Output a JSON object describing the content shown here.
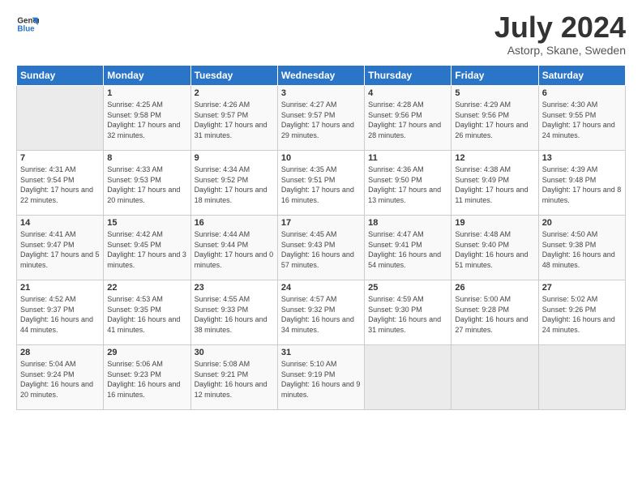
{
  "logo": {
    "line1": "General",
    "line2": "Blue"
  },
  "title": "July 2024",
  "subtitle": "Astorp, Skane, Sweden",
  "days_header": [
    "Sunday",
    "Monday",
    "Tuesday",
    "Wednesday",
    "Thursday",
    "Friday",
    "Saturday"
  ],
  "weeks": [
    [
      {
        "day": "",
        "info": ""
      },
      {
        "day": "1",
        "info": "Sunrise: 4:25 AM\nSunset: 9:58 PM\nDaylight: 17 hours and 32 minutes."
      },
      {
        "day": "2",
        "info": "Sunrise: 4:26 AM\nSunset: 9:57 PM\nDaylight: 17 hours and 31 minutes."
      },
      {
        "day": "3",
        "info": "Sunrise: 4:27 AM\nSunset: 9:57 PM\nDaylight: 17 hours and 29 minutes."
      },
      {
        "day": "4",
        "info": "Sunrise: 4:28 AM\nSunset: 9:56 PM\nDaylight: 17 hours and 28 minutes."
      },
      {
        "day": "5",
        "info": "Sunrise: 4:29 AM\nSunset: 9:56 PM\nDaylight: 17 hours and 26 minutes."
      },
      {
        "day": "6",
        "info": "Sunrise: 4:30 AM\nSunset: 9:55 PM\nDaylight: 17 hours and 24 minutes."
      }
    ],
    [
      {
        "day": "7",
        "info": "Sunrise: 4:31 AM\nSunset: 9:54 PM\nDaylight: 17 hours and 22 minutes."
      },
      {
        "day": "8",
        "info": "Sunrise: 4:33 AM\nSunset: 9:53 PM\nDaylight: 17 hours and 20 minutes."
      },
      {
        "day": "9",
        "info": "Sunrise: 4:34 AM\nSunset: 9:52 PM\nDaylight: 17 hours and 18 minutes."
      },
      {
        "day": "10",
        "info": "Sunrise: 4:35 AM\nSunset: 9:51 PM\nDaylight: 17 hours and 16 minutes."
      },
      {
        "day": "11",
        "info": "Sunrise: 4:36 AM\nSunset: 9:50 PM\nDaylight: 17 hours and 13 minutes."
      },
      {
        "day": "12",
        "info": "Sunrise: 4:38 AM\nSunset: 9:49 PM\nDaylight: 17 hours and 11 minutes."
      },
      {
        "day": "13",
        "info": "Sunrise: 4:39 AM\nSunset: 9:48 PM\nDaylight: 17 hours and 8 minutes."
      }
    ],
    [
      {
        "day": "14",
        "info": "Sunrise: 4:41 AM\nSunset: 9:47 PM\nDaylight: 17 hours and 5 minutes."
      },
      {
        "day": "15",
        "info": "Sunrise: 4:42 AM\nSunset: 9:45 PM\nDaylight: 17 hours and 3 minutes."
      },
      {
        "day": "16",
        "info": "Sunrise: 4:44 AM\nSunset: 9:44 PM\nDaylight: 17 hours and 0 minutes."
      },
      {
        "day": "17",
        "info": "Sunrise: 4:45 AM\nSunset: 9:43 PM\nDaylight: 16 hours and 57 minutes."
      },
      {
        "day": "18",
        "info": "Sunrise: 4:47 AM\nSunset: 9:41 PM\nDaylight: 16 hours and 54 minutes."
      },
      {
        "day": "19",
        "info": "Sunrise: 4:48 AM\nSunset: 9:40 PM\nDaylight: 16 hours and 51 minutes."
      },
      {
        "day": "20",
        "info": "Sunrise: 4:50 AM\nSunset: 9:38 PM\nDaylight: 16 hours and 48 minutes."
      }
    ],
    [
      {
        "day": "21",
        "info": "Sunrise: 4:52 AM\nSunset: 9:37 PM\nDaylight: 16 hours and 44 minutes."
      },
      {
        "day": "22",
        "info": "Sunrise: 4:53 AM\nSunset: 9:35 PM\nDaylight: 16 hours and 41 minutes."
      },
      {
        "day": "23",
        "info": "Sunrise: 4:55 AM\nSunset: 9:33 PM\nDaylight: 16 hours and 38 minutes."
      },
      {
        "day": "24",
        "info": "Sunrise: 4:57 AM\nSunset: 9:32 PM\nDaylight: 16 hours and 34 minutes."
      },
      {
        "day": "25",
        "info": "Sunrise: 4:59 AM\nSunset: 9:30 PM\nDaylight: 16 hours and 31 minutes."
      },
      {
        "day": "26",
        "info": "Sunrise: 5:00 AM\nSunset: 9:28 PM\nDaylight: 16 hours and 27 minutes."
      },
      {
        "day": "27",
        "info": "Sunrise: 5:02 AM\nSunset: 9:26 PM\nDaylight: 16 hours and 24 minutes."
      }
    ],
    [
      {
        "day": "28",
        "info": "Sunrise: 5:04 AM\nSunset: 9:24 PM\nDaylight: 16 hours and 20 minutes."
      },
      {
        "day": "29",
        "info": "Sunrise: 5:06 AM\nSunset: 9:23 PM\nDaylight: 16 hours and 16 minutes."
      },
      {
        "day": "30",
        "info": "Sunrise: 5:08 AM\nSunset: 9:21 PM\nDaylight: 16 hours and 12 minutes."
      },
      {
        "day": "31",
        "info": "Sunrise: 5:10 AM\nSunset: 9:19 PM\nDaylight: 16 hours and 9 minutes."
      },
      {
        "day": "",
        "info": ""
      },
      {
        "day": "",
        "info": ""
      },
      {
        "day": "",
        "info": ""
      }
    ]
  ]
}
